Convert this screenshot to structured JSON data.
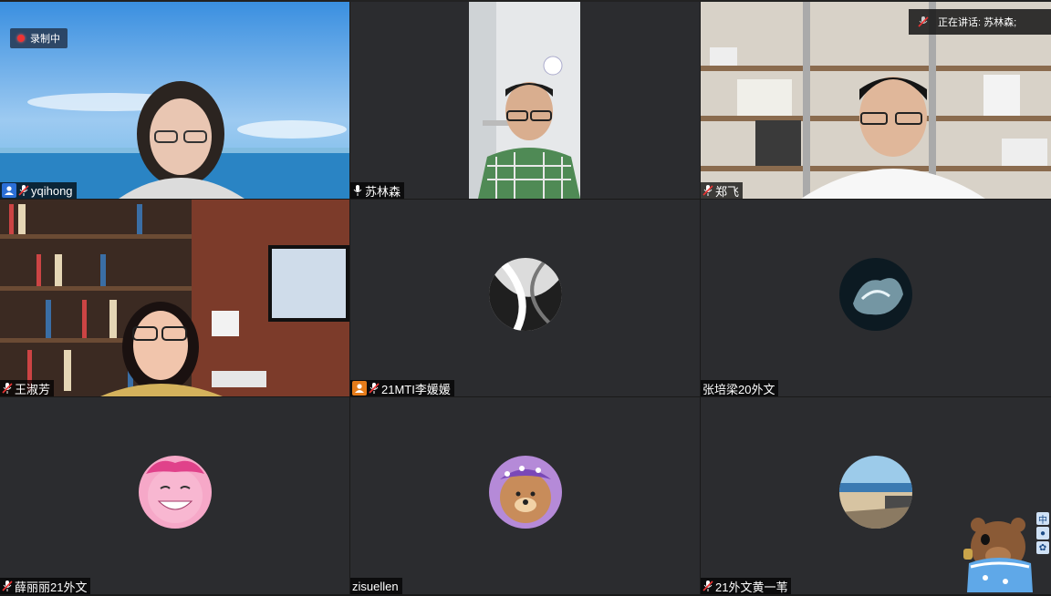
{
  "recording": {
    "label": "录制中"
  },
  "speaking": {
    "label": "正在讲话: 苏林森;"
  },
  "participants": [
    {
      "name": "yqihong"
    },
    {
      "name": "苏林森"
    },
    {
      "name": "郑飞"
    },
    {
      "name": "王淑芳"
    },
    {
      "name": "21MTI李媛媛"
    },
    {
      "name": "张培梁20外文"
    },
    {
      "name": "薛丽丽21外文"
    },
    {
      "name": "zisuellen"
    },
    {
      "name": "21外文黄一苇"
    }
  ],
  "side_tools": {
    "ime": "中"
  },
  "colors": {
    "host_badge": "#2b6fd6",
    "cohost_badge": "#e57c1a",
    "active_border": "#2f7d3c",
    "recording_dot": "#e33333"
  }
}
